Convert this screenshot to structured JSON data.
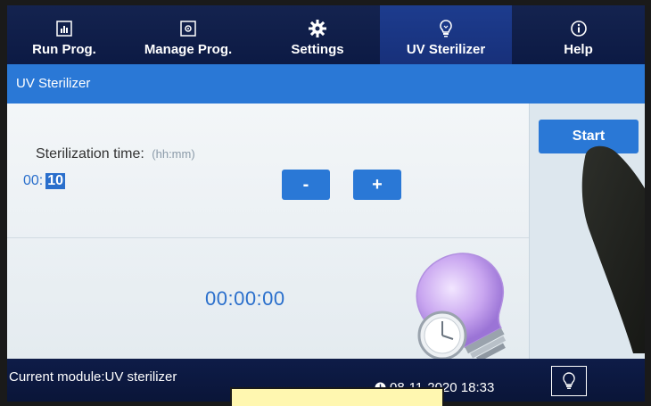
{
  "tabs": [
    {
      "label": "Run Prog.",
      "icon": "run-program-icon",
      "active": false
    },
    {
      "label": "Manage Prog.",
      "icon": "manage-program-icon",
      "active": false
    },
    {
      "label": "Settings",
      "icon": "gear-icon",
      "active": false
    },
    {
      "label": "UV Sterilizer",
      "icon": "uv-bulb-icon",
      "active": true
    },
    {
      "label": "Help",
      "icon": "info-icon",
      "active": false
    }
  ],
  "title": "UV Sterilizer",
  "sterilization": {
    "label": "Sterilization time:",
    "hint": "(hh:mm)",
    "hours": "00",
    "separator": ":",
    "minutes": "10"
  },
  "buttons": {
    "minus": "-",
    "plus": "+",
    "start": "Start"
  },
  "countdown": "00:00:00",
  "status": {
    "module": "Current module:UV sterilizer",
    "datetime": "08-11-2020 18:33"
  },
  "colors": {
    "accent": "#2a78d6",
    "tabbar": "#14234f",
    "text_accent": "#2a6fcc"
  }
}
